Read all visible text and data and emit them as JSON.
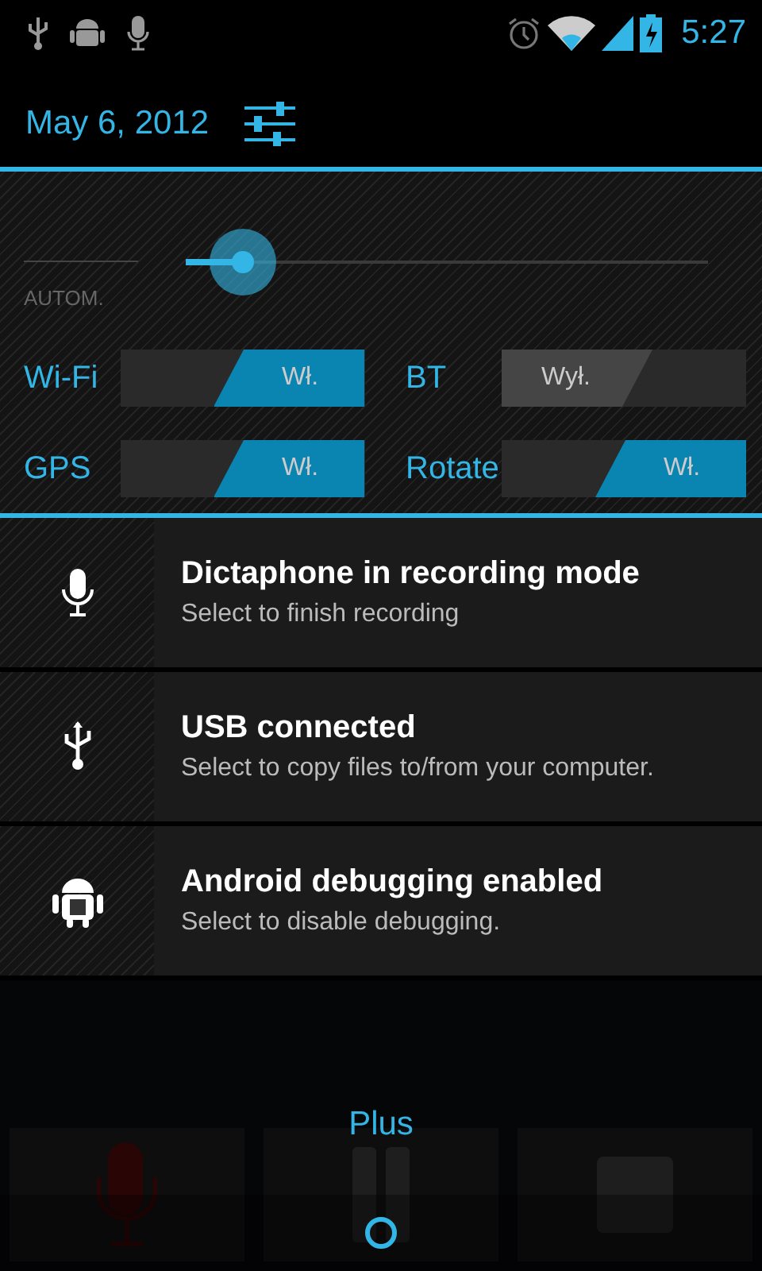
{
  "status_bar": {
    "time": "5:27"
  },
  "header": {
    "date": "May 6, 2012"
  },
  "brightness": {
    "auto_label": "AUTOM.",
    "level": 0.11
  },
  "toggles": [
    {
      "label": "Wi-Fi",
      "state_text": "Wł.",
      "on": true
    },
    {
      "label": "BT",
      "state_text": "Wył.",
      "on": false
    },
    {
      "label": "GPS",
      "state_text": "Wł.",
      "on": true
    },
    {
      "label": "Rotate",
      "state_text": "Wł.",
      "on": true
    }
  ],
  "notifications": [
    {
      "kind": "mic",
      "title": "Dictaphone in recording mode",
      "text": "Select to finish recording"
    },
    {
      "kind": "usb",
      "title": "USB connected",
      "text": "Select to copy files to/from your computer."
    },
    {
      "kind": "android",
      "title": "Android debugging enabled",
      "text": "Select to disable debugging."
    }
  ],
  "background_app": {
    "label": "Plus",
    "tiles": [
      {
        "kind": "mic"
      },
      {
        "kind": "pause"
      },
      {
        "kind": "stop"
      }
    ]
  }
}
